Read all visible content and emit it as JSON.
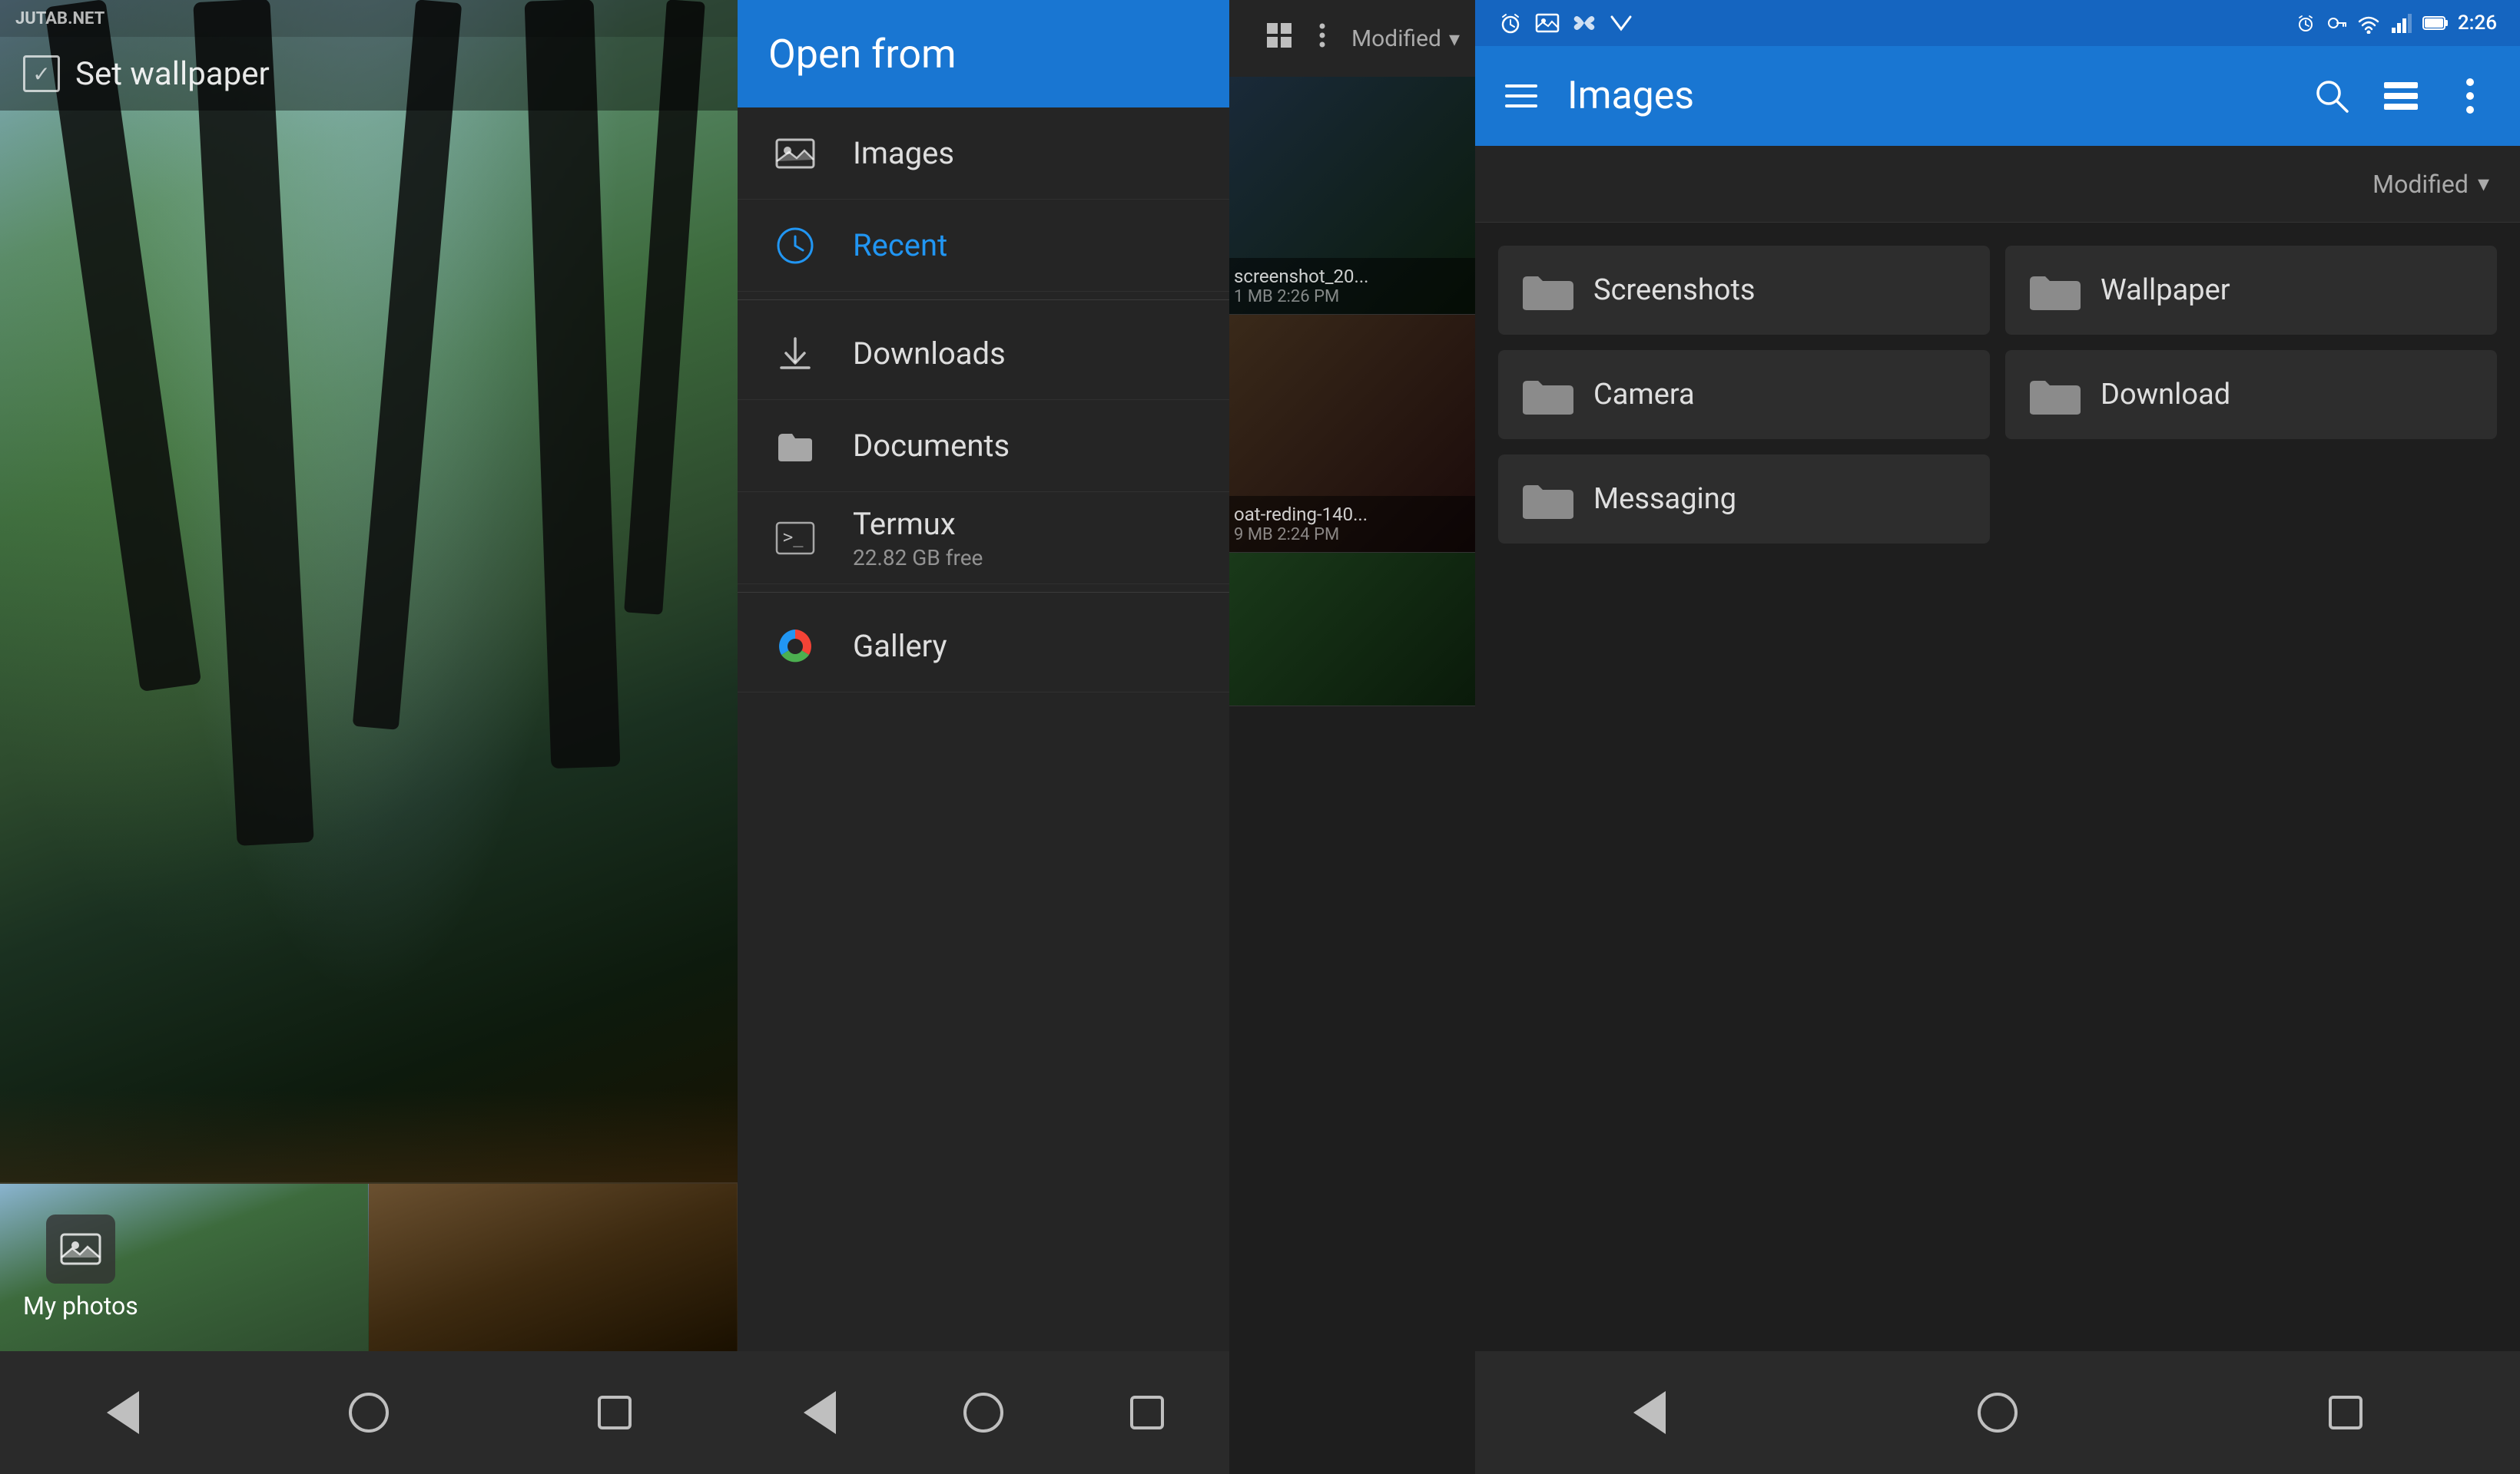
{
  "panel1": {
    "statusbar": {
      "logo": "JUTAB.NET"
    },
    "toolbar": {
      "set_wallpaper_label": "Set wallpaper"
    },
    "my_photos": {
      "label": "My photos"
    },
    "nav": {
      "back_label": "back",
      "home_label": "home",
      "recents_label": "recents"
    }
  },
  "panel2": {
    "header": {
      "title": "Open from"
    },
    "sort": {
      "label": "Modified",
      "arrow": "▾"
    },
    "menu_items": [
      {
        "id": "images",
        "label": "Images",
        "icon": "image-icon",
        "active": false
      },
      {
        "id": "recent",
        "label": "Recent",
        "icon": "clock-icon",
        "active": true
      },
      {
        "id": "downloads",
        "label": "Downloads",
        "icon": "download-icon",
        "active": false
      },
      {
        "id": "documents",
        "label": "Documents",
        "icon": "folder-icon",
        "active": false
      },
      {
        "id": "termux",
        "label": "Termux",
        "sub": "22.82 GB free",
        "icon": "terminal-icon",
        "active": false
      },
      {
        "id": "gallery",
        "label": "Gallery",
        "icon": "gallery-icon",
        "active": false
      }
    ],
    "bg_images": [
      {
        "name": "screenshot_20...",
        "meta": "1 MB  2:26 PM"
      },
      {
        "name": "oat-reding-140...",
        "meta": "9 MB  2:24 PM"
      },
      {
        "name": "",
        "meta": ""
      }
    ],
    "nav": {
      "back_label": "back",
      "home_label": "home",
      "recents_label": "recents"
    }
  },
  "panel3": {
    "statusbar": {
      "time": "2:26",
      "icons": [
        "alarm-icon",
        "key-icon",
        "wifi-icon",
        "signal-icon",
        "battery-icon"
      ]
    },
    "toolbar": {
      "title": "Images",
      "menu_label": "menu",
      "search_label": "search",
      "list_view_label": "list view",
      "more_label": "more options"
    },
    "sort": {
      "label": "Modified",
      "arrow": "▾"
    },
    "folders": [
      {
        "id": "screenshots",
        "name": "Screenshots"
      },
      {
        "id": "wallpaper",
        "name": "Wallpaper"
      },
      {
        "id": "camera",
        "name": "Camera"
      },
      {
        "id": "download",
        "name": "Download"
      },
      {
        "id": "messaging",
        "name": "Messaging"
      }
    ],
    "nav": {
      "back_label": "back",
      "home_label": "home",
      "recents_label": "recents"
    }
  }
}
